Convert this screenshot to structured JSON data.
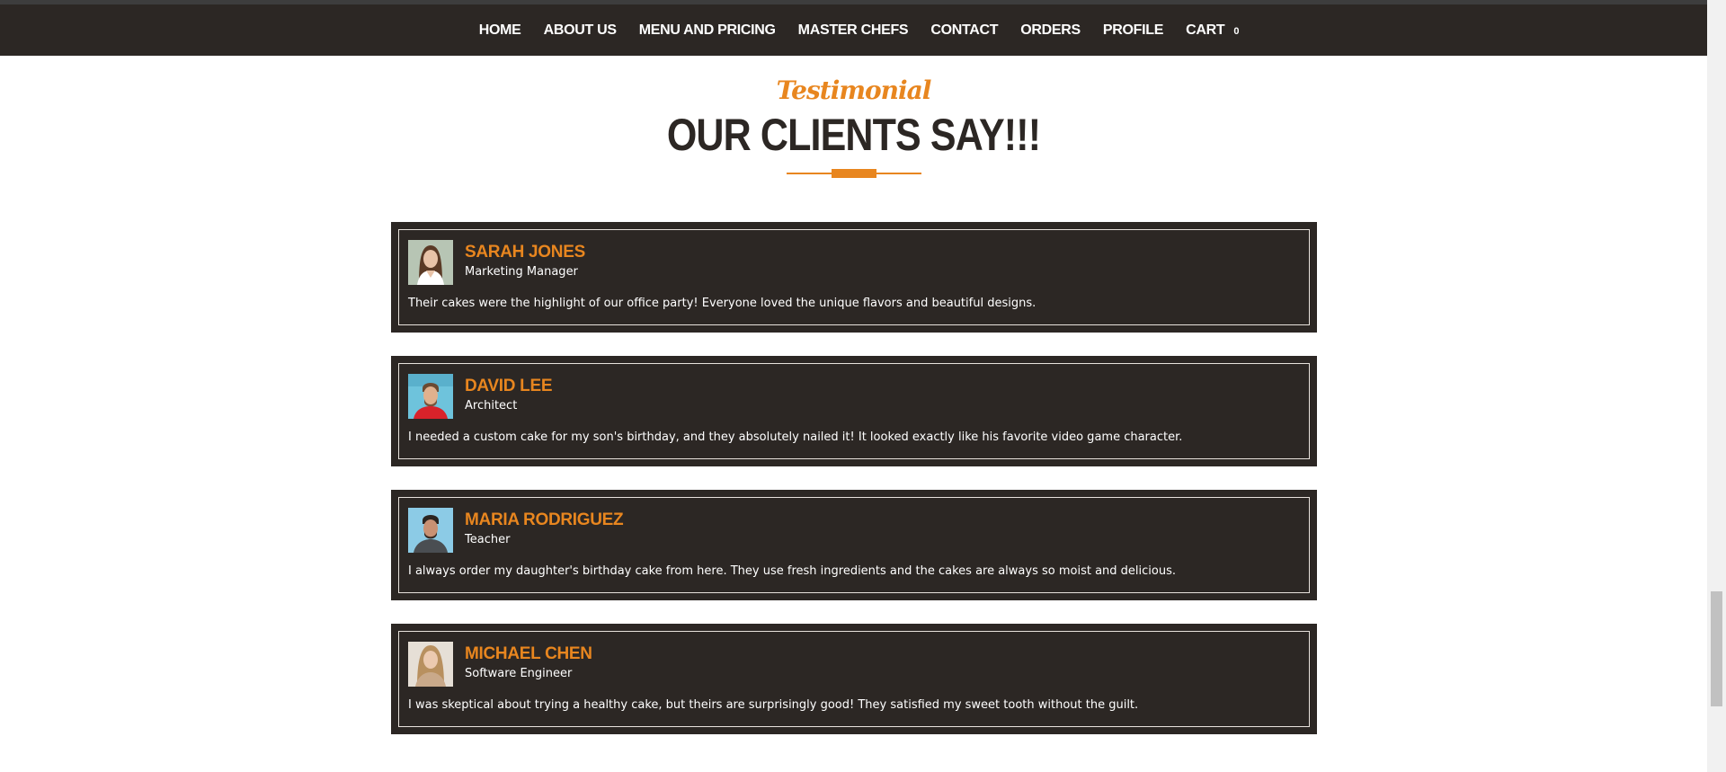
{
  "nav": {
    "items": [
      {
        "label": "HOME"
      },
      {
        "label": "ABOUT US"
      },
      {
        "label": "MENU AND PRICING"
      },
      {
        "label": "MASTER CHEFS"
      },
      {
        "label": "CONTACT"
      },
      {
        "label": "ORDERS"
      },
      {
        "label": "PROFILE"
      }
    ],
    "cart_label": "CART",
    "cart_count": "0"
  },
  "section": {
    "subtitle": "Testimonial",
    "title": "OUR CLIENTS SAY!!!"
  },
  "testimonials": [
    {
      "name": "SARAH JONES",
      "role": "Marketing Manager",
      "quote": "Their cakes were the highlight of our office party! Everyone loved the unique flavors and beautiful designs."
    },
    {
      "name": "DAVID LEE",
      "role": "Architect",
      "quote": "I needed a custom cake for my son's birthday, and they absolutely nailed it! It looked exactly like his favorite video game character."
    },
    {
      "name": "MARIA RODRIGUEZ",
      "role": "Teacher",
      "quote": "I always order my daughter's birthday cake from here. They use fresh ingredients and the cakes are always so moist and delicious."
    },
    {
      "name": "MICHAEL CHEN",
      "role": "Software Engineer",
      "quote": "I was skeptical about trying a healthy cake, but theirs are surprisingly good! They satisfied my sweet tooth without the guilt."
    }
  ],
  "colors": {
    "accent": "#e8861f",
    "dark": "#2c2724",
    "white": "#ffffff"
  }
}
